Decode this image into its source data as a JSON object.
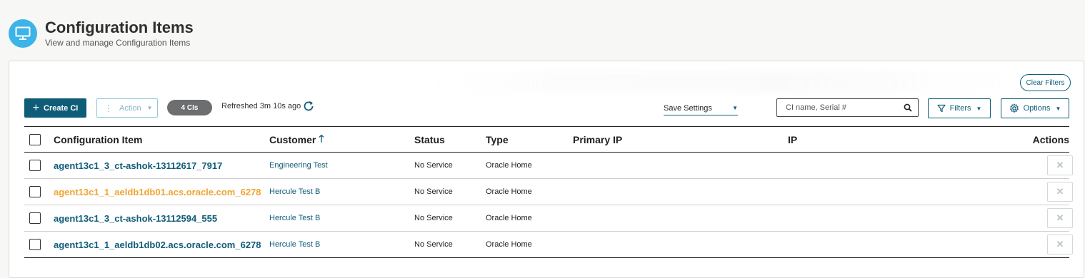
{
  "header": {
    "title": "Configuration Items",
    "subtitle": "View and manage Configuration Items",
    "icon": "monitor-icon",
    "icon_color": "#3cb4e7"
  },
  "toolbar": {
    "clear_filters_label": "Clear Filters",
    "create_label": "Create CI",
    "action_label": "Action",
    "count_badge": "4 CIs",
    "refreshed_text": "Refreshed 3m 10s ago",
    "save_settings_label": "Save Settings",
    "search_placeholder": "CI name, Serial #",
    "filters_label": "Filters",
    "options_label": "Options"
  },
  "table": {
    "columns": {
      "ci": "Configuration Item",
      "customer": "Customer",
      "status": "Status",
      "type": "Type",
      "primary_ip": "Primary IP",
      "ip": "IP",
      "actions": "Actions"
    },
    "rows": [
      {
        "ci": "agent13c1_3_ct-ashok-13112617_7917",
        "ci_highlight": false,
        "customer": "Engineering Test",
        "status": "No Service",
        "type": "Oracle Home",
        "primary_ip": "",
        "ip": ""
      },
      {
        "ci": "agent13c1_1_aeldb1db01.acs.oracle.com_6278",
        "ci_highlight": true,
        "customer": "Hercule Test B",
        "status": "No Service",
        "type": "Oracle Home",
        "primary_ip": "",
        "ip": ""
      },
      {
        "ci": "agent13c1_3_ct-ashok-13112594_555",
        "ci_highlight": false,
        "customer": "Hercule Test B",
        "status": "No Service",
        "type": "Oracle Home",
        "primary_ip": "",
        "ip": ""
      },
      {
        "ci": "agent13c1_1_aeldb1db02.acs.oracle.com_6278",
        "ci_highlight": false,
        "customer": "Hercule Test B",
        "status": "No Service",
        "type": "Oracle Home",
        "primary_ip": "",
        "ip": ""
      }
    ]
  },
  "colors": {
    "primary": "#0f5c78",
    "highlight": "#f0a431",
    "badge": "#6d6e70"
  }
}
